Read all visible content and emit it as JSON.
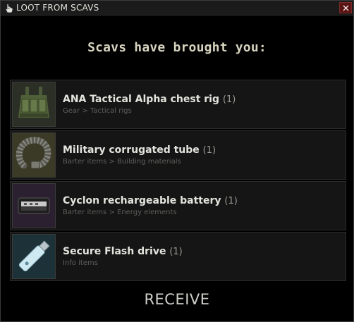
{
  "window": {
    "title": "LOOT FROM SCAVS",
    "close_icon": "close-icon",
    "title_icon": "hand-pointer-icon"
  },
  "heading": "Scavs have brought you:",
  "items": [
    {
      "name": "ANA Tactical Alpha chest rig",
      "count": "(1)",
      "category": "Gear > Tactical rigs",
      "icon": "chest-rig-icon",
      "thumb_bg": "#2b2f26"
    },
    {
      "name": "Military corrugated tube",
      "count": "(1)",
      "category": "Barter items > Building materials",
      "icon": "corrugated-tube-icon",
      "thumb_bg": "#3a3a26"
    },
    {
      "name": "Cyclon rechargeable battery",
      "count": "(1)",
      "category": "Barter items > Energy elements",
      "icon": "battery-icon",
      "thumb_bg": "#2a2030"
    },
    {
      "name": "Secure Flash drive",
      "count": "(1)",
      "category": "Info items",
      "icon": "flash-drive-icon",
      "thumb_bg": "#1c3238"
    }
  ],
  "receive_label": "RECEIVE",
  "colors": {
    "close_button": "#5b1414",
    "background": "#000000"
  }
}
